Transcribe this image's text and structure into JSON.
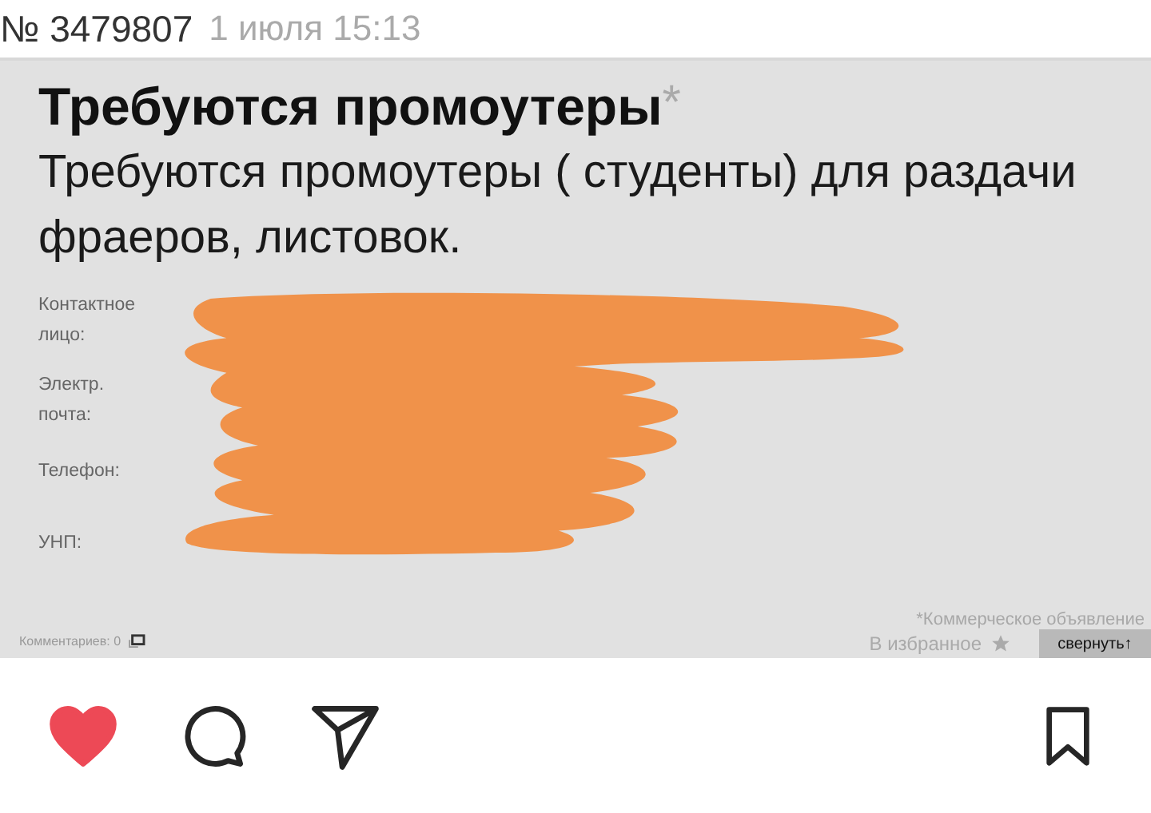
{
  "header": {
    "number": "№ 3479807",
    "date": "1 июля 15:13"
  },
  "ad": {
    "title": "Требуются промоутеры",
    "title_mark": "*",
    "description": "Требуются промоутеры ( студенты) для раздачи фраеров, листовок.",
    "contacts": [
      {
        "label": "Контактное лицо:"
      },
      {
        "label": "Электр. почта:"
      },
      {
        "label": "Телефон:"
      },
      {
        "label": "УНП:"
      }
    ],
    "commercial_note": "*Коммерческое объявление",
    "comments": "Комментариев: 0",
    "favorite": "В избранное",
    "collapse": "свернуть↑"
  },
  "actions": {
    "liked": true,
    "saved": false
  }
}
